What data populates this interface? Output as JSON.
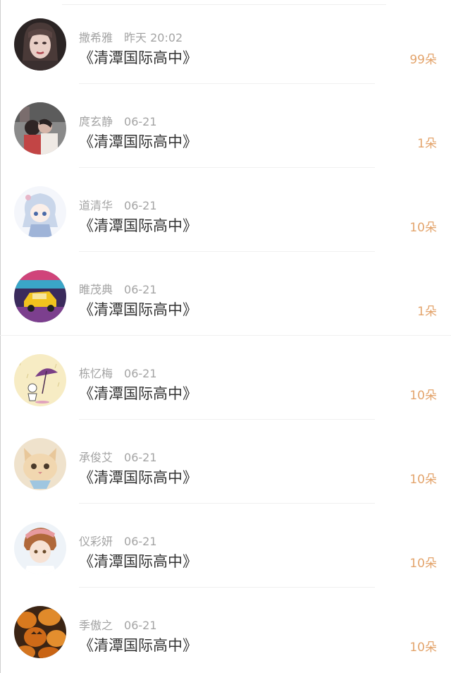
{
  "items": [
    {
      "name": "撒希雅",
      "time": "昨天 20:02",
      "book": "《清潭国际高中》",
      "count": "99朵",
      "avatar": "girl-portrait-icon"
    },
    {
      "name": "庹玄静",
      "time": "06-21",
      "book": "《清潭国际高中》",
      "count": "1朵",
      "avatar": "couple-photo-icon"
    },
    {
      "name": "道清华",
      "time": "06-21",
      "book": "《清潭国际高中》",
      "count": "10朵",
      "avatar": "anime-chibi-icon"
    },
    {
      "name": "睢茂典",
      "time": "06-21",
      "book": "《清潭国际高中》",
      "count": "1朵",
      "avatar": "toy-car-icon"
    },
    {
      "name": "栋忆梅",
      "time": "06-21",
      "book": "《清潭国际高中》",
      "count": "10朵",
      "avatar": "umbrella-cartoon-icon"
    },
    {
      "name": "承俊艾",
      "time": "06-21",
      "book": "《清潭国际高中》",
      "count": "10朵",
      "avatar": "kitten-icon"
    },
    {
      "name": "仪彩妍",
      "time": "06-21",
      "book": "《清潭国际高中》",
      "count": "10朵",
      "avatar": "anime-boy-icon"
    },
    {
      "name": "季傲之",
      "time": "06-21",
      "book": "《清潭国际高中》",
      "count": "10朵",
      "avatar": "pumpkins-icon"
    }
  ],
  "colors": {
    "count": "#e3a46c",
    "meta": "#a4a4a4",
    "title": "#333333"
  }
}
